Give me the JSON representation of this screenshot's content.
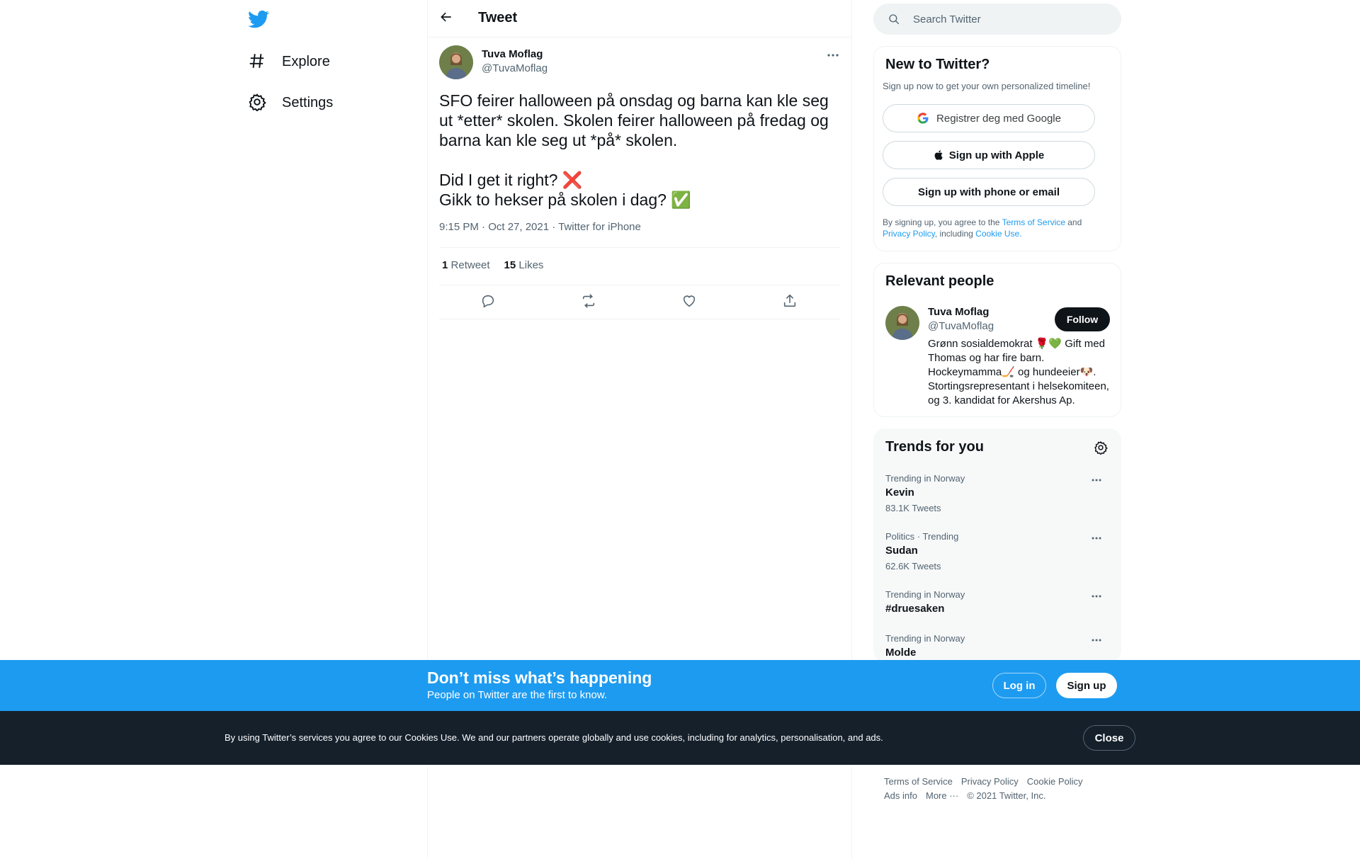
{
  "nav": {
    "items": [
      {
        "label": "Explore",
        "icon": "hashtag-icon"
      },
      {
        "label": "Settings",
        "icon": "gear-icon"
      }
    ]
  },
  "header": {
    "title": "Tweet"
  },
  "tweet": {
    "author_name": "Tuva Moflag",
    "author_handle": "@TuvaMoflag",
    "text": "SFO feirer halloween på onsdag og barna kan kle seg ut *etter* skolen. Skolen feirer halloween på fredag og barna kan kle seg ut *på* skolen.\n\nDid I get it right? ❌\nGikk to hekser på skolen i dag? ✅",
    "meta": "9:15 PM · Oct 27, 2021 · Twitter for iPhone",
    "retweets_count": "1",
    "retweets_label": "Retweet",
    "likes_count": "15",
    "likes_label": "Likes"
  },
  "search": {
    "placeholder": "Search Twitter"
  },
  "new_to_twitter": {
    "title": "New to Twitter?",
    "subtitle": "Sign up now to get your own personalized timeline!",
    "google_label": "Registrer deg med Google",
    "apple_label": "Sign up with Apple",
    "phone_label": "Sign up with phone or email",
    "legal_1": "By signing up, you agree to the ",
    "terms": "Terms of Service",
    "legal_2": " and",
    "privacy": "Privacy Policy",
    "legal_3": ", including ",
    "cookie": "Cookie Use."
  },
  "relevant_people": {
    "title": "Relevant people",
    "name": "Tuva Moflag",
    "handle": "@TuvaMoflag",
    "follow_label": "Follow",
    "bio": "Grønn sosialdemokrat 🌹💚 Gift med Thomas og har fire barn. Hockeymamma🏒 og hundeeier🐶. Stortingsrepresentant i helsekomiteen, og 3. kandidat for Akershus Ap."
  },
  "trends": {
    "title": "Trends for you",
    "items": [
      {
        "context": "Trending in Norway",
        "title": "Kevin",
        "count": "83.1K Tweets"
      },
      {
        "context": "Politics · Trending",
        "title": "Sudan",
        "count": "62.6K Tweets"
      },
      {
        "context": "Trending in Norway",
        "title": "#druesaken",
        "count": ""
      },
      {
        "context": "Trending in Norway",
        "title": "Molde",
        "count": ""
      }
    ]
  },
  "footer": {
    "row1": [
      "Terms of Service",
      "Privacy Policy",
      "Cookie Policy"
    ],
    "row2": [
      "Ads info",
      "More ···",
      "© 2021 Twitter, Inc."
    ]
  },
  "signup_bar": {
    "title": "Don’t miss what’s happening",
    "subtitle": "People on Twitter are the first to know.",
    "login_label": "Log in",
    "signup_label": "Sign up"
  },
  "cookie_bar": {
    "text": "By using Twitter’s services you agree to our Cookies Use. We and our partners operate globally and use cookies, including for analytics, personalisation, and ads.",
    "close_label": "Close"
  },
  "colors": {
    "accent": "#1d9bf0",
    "text": "#0f1419",
    "muted": "#536471",
    "cookie_bg": "#15202b"
  }
}
